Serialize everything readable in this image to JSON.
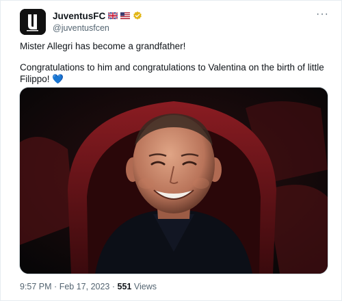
{
  "tweet": {
    "display_name": "JuventusFC",
    "flags": [
      "uk-flag",
      "us-flag"
    ],
    "handle": "@juventusfcen",
    "text_line1": "Mister Allegri has become a grandfather!",
    "text_line2": "Congratulations to him and congratulations to Valentina on the birth of little Filippo!",
    "heart_emoji": "💙",
    "time": "9:57 PM",
    "separator": "·",
    "date": "Feb 17, 2023",
    "views_count": "551",
    "views_label": "Views"
  },
  "colors": {
    "verified_badge": "#e2b719",
    "heart": "#5db3f1",
    "secondary_text": "#536471"
  },
  "icons": {
    "avatar": "juventus-logo-icon",
    "more": "more-options-icon",
    "verified": "verified-badge-icon"
  }
}
